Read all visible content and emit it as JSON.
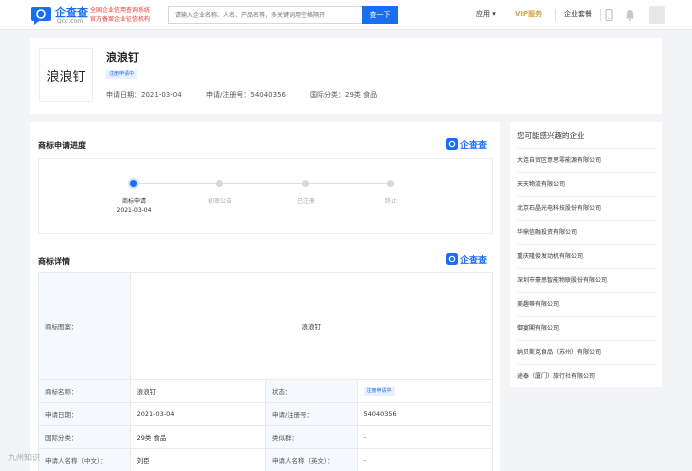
{
  "header": {
    "logo_text": "企查查",
    "logo_sub": "Qcc.com",
    "slogan_line1": "全国企业信用查询系统",
    "slogan_line2": "官方备案企业征信机构",
    "search_placeholder": "请输入企业名称、人名、产品名等，多关键词用空格隔开",
    "search_button": "查一下",
    "nav_app": "应用 ▾",
    "nav_vip": "VIP服务",
    "nav_enterprise": "企业套餐"
  },
  "trademark": {
    "name": "浪浪钉",
    "status": "注册申请中",
    "apply_date_label": "申请日期：",
    "apply_date": "2021-03-04",
    "reg_no_label": "申请/注册号：",
    "reg_no": "54040356",
    "class_label": "国际分类：",
    "class_value": "29类 食品"
  },
  "progress": {
    "title": "商标申请进度",
    "brand": "企查查",
    "steps": [
      {
        "label": "商标申请",
        "date": "2021-03-04",
        "active": true
      },
      {
        "label": "初审公告",
        "date": "",
        "active": false
      },
      {
        "label": "已注册",
        "date": "",
        "active": false
      },
      {
        "label": "终止",
        "date": "",
        "active": false
      }
    ]
  },
  "details": {
    "title": "商标详情",
    "brand": "企查查",
    "image_label": "商标图案：",
    "image_text": "浪浪钉",
    "rows": [
      {
        "l1": "商标名称：",
        "v1": "浪浪钉",
        "l2": "状态：",
        "v2": "注册申请中"
      },
      {
        "l1": "申请日期：",
        "v1": "2021-03-04",
        "l2": "申请/注册号：",
        "v2": "54040356"
      },
      {
        "l1": "国际分类：",
        "v1": "29类 食品",
        "l2": "类似群：",
        "v2": "-"
      },
      {
        "l1": "申请人名称（中文）：",
        "v1": "刘臣",
        "l2": "申请人名称（英文）：",
        "v2": "-"
      }
    ]
  },
  "sidebar": {
    "title": "您可能感兴趣的企业",
    "items": [
      "大连自贸区意思零能源有限公司",
      "天天物流有限公司",
      "北京石晶光电科技股份有限公司",
      "华鼎信融投资有限公司",
      "重庆隆俊发动机有限公司",
      "深圳市豪思智能物联股份有限公司",
      "美趣蒂有限公司",
      "御宴閣有限公司",
      "纳贝斯克食品（苏州）有限公司",
      "途泰（厦门）旅行社有限公司"
    ]
  },
  "watermark": "九州知识",
  "colors": {
    "accent": "#1a6ff0",
    "vip": "#d4a24a",
    "slogan": "#e6362c"
  }
}
